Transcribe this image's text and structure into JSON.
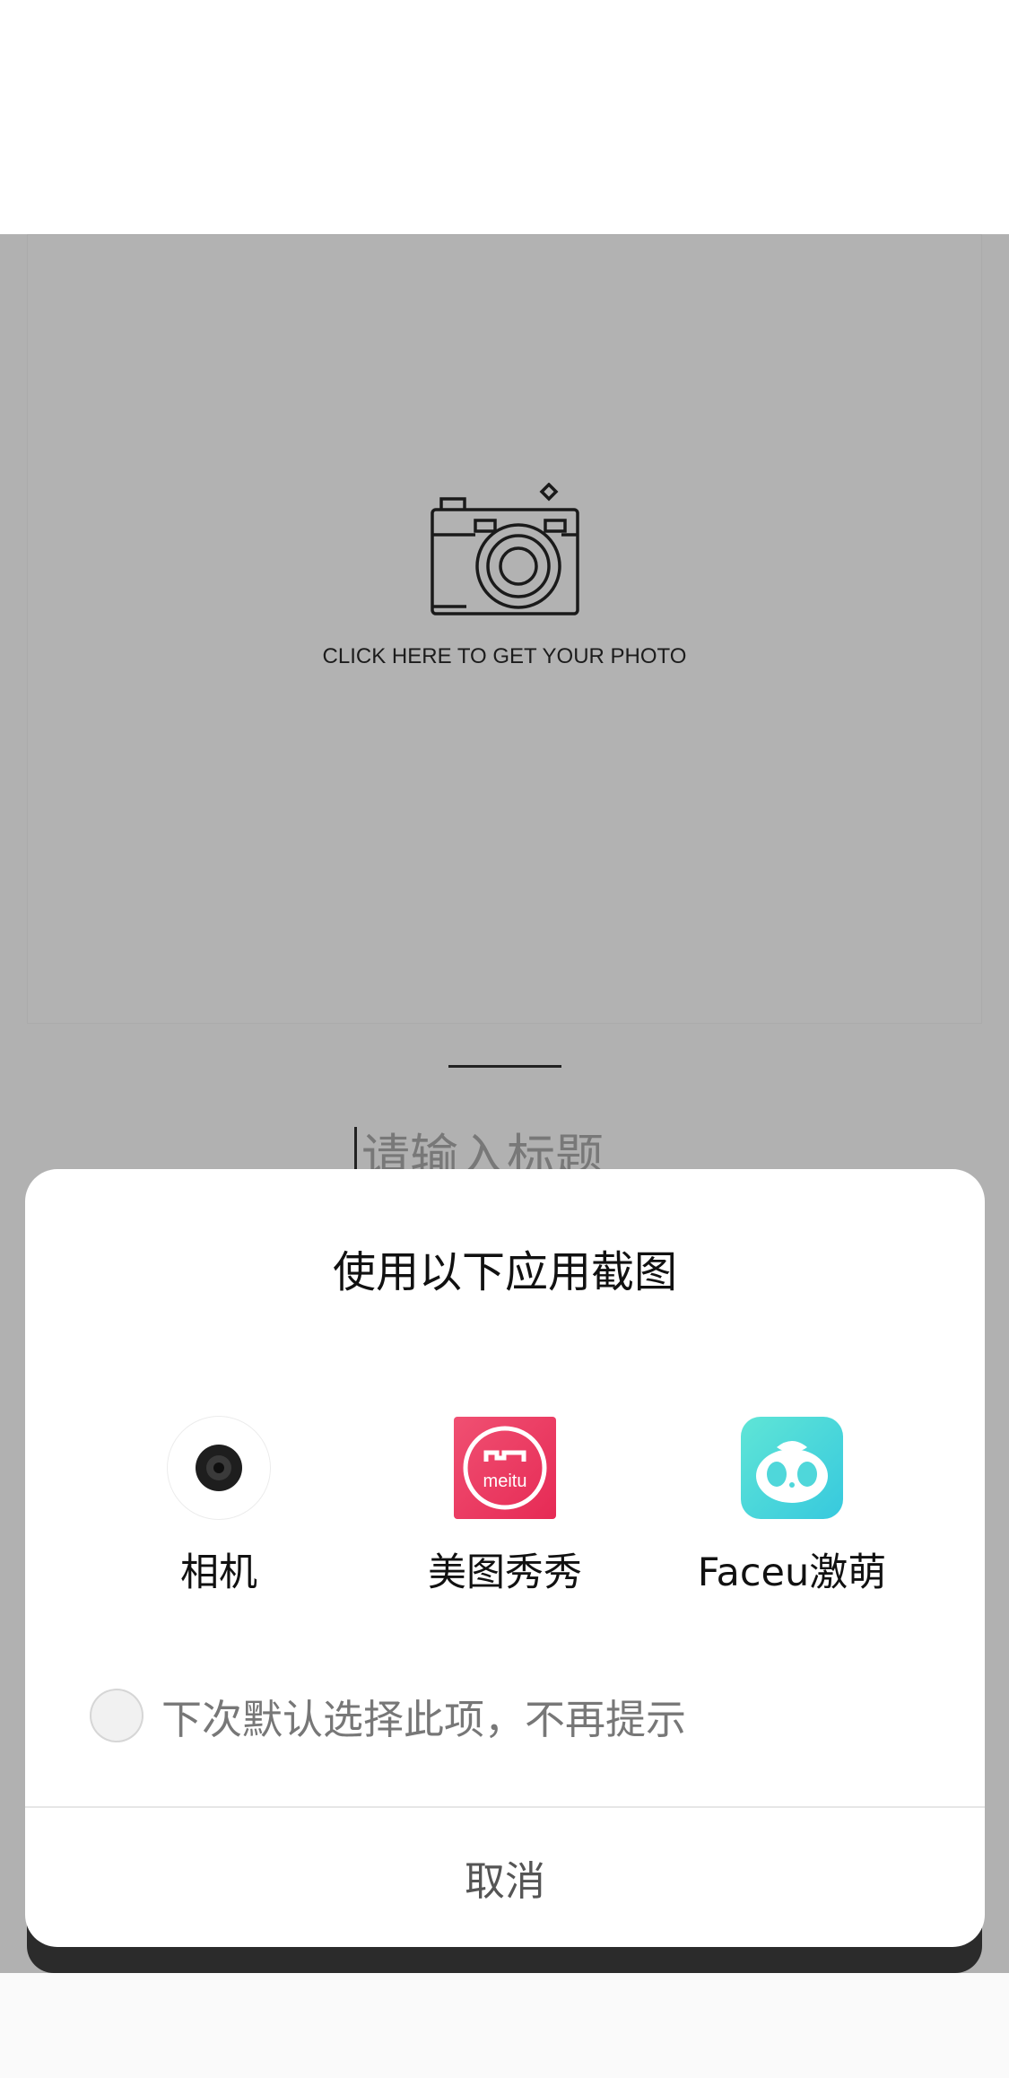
{
  "photo_area": {
    "caption": "CLICK HERE TO GET YOUR PHOTO"
  },
  "title_input": {
    "placeholder": "请输入标题"
  },
  "sheet": {
    "title": "使用以下应用截图",
    "apps": [
      {
        "label": "相机",
        "icon": "camera-lens-icon"
      },
      {
        "label": "美图秀秀",
        "icon": "meitu-icon",
        "icon_text": "meitu"
      },
      {
        "label": "Faceu激萌",
        "icon": "faceu-icon"
      }
    ],
    "default_option": {
      "label": "下次默认选择此项，不再提示",
      "checked": false
    },
    "cancel_label": "取消"
  },
  "colors": {
    "overlay": "#b1b1b1",
    "meitu_brand": "#e93a5f",
    "faceu_brand": "#4ed8da"
  }
}
